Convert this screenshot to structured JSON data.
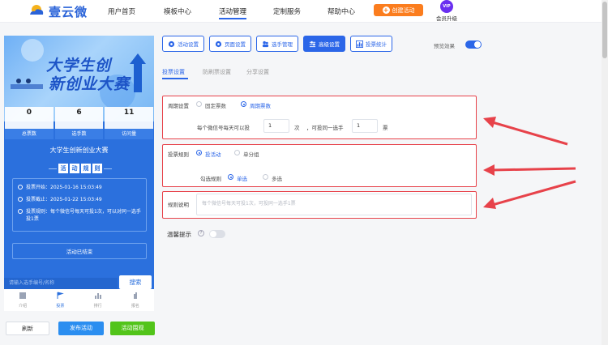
{
  "header": {
    "brand": "壹云微",
    "nav": [
      "用户首页",
      "模板中心",
      "活动管理",
      "定制服务",
      "帮助中心"
    ],
    "active_nav": "活动管理",
    "create_label": "创建活动",
    "vip_badge": "VIP",
    "vip_label": "会员升级"
  },
  "preview": {
    "banner_line1": "大学生创",
    "banner_line2": "新创业大赛",
    "stats": [
      {
        "value": "0",
        "label": "总票数"
      },
      {
        "value": "6",
        "label": "选手数"
      },
      {
        "value": "11",
        "label": "访问量"
      }
    ],
    "title": "大学生创新创业大赛",
    "rule_chars": [
      "活",
      "动",
      "规",
      "则"
    ],
    "rules": [
      "投票开始：2025-01-16 15:03:49",
      "投票截止：2025-01-22 15:03:49",
      "投票规则：每个微信号每天可投1次，可以对同一选手投1票"
    ],
    "end_label": "活动已结束",
    "search_placeholder": "请输入选手编号/名称",
    "search_label": "搜索",
    "tabs": [
      "介绍",
      "投票",
      "排行",
      "报名"
    ],
    "active_tab": "投票"
  },
  "bottom_buttons": {
    "refresh": "刷新",
    "publish": "发布活动",
    "watch": "活动围观"
  },
  "toolbar": {
    "buttons": [
      "活动设置",
      "页面设置",
      "选手管理",
      "高级设置",
      "投票统计"
    ],
    "active": "高级设置",
    "preview_label": "预览效果",
    "preview_on": true
  },
  "subtabs": {
    "items": [
      "投票设置",
      "防刷票设置",
      "分享设置"
    ],
    "active": "投票设置"
  },
  "cycle": {
    "label": "周期设置",
    "options": [
      "固定票数",
      "周期票数"
    ],
    "selected": "周期票数",
    "per_day_label": "每个微信号每天可以投",
    "per_day_value": "1",
    "unit_times": "次",
    "per_player_label": "，可投同一选手",
    "per_player_value": "1",
    "unit_votes": "票"
  },
  "vote_rule": {
    "label": "投票规则",
    "options": [
      "投活动",
      "单分组"
    ],
    "selected": "投活动",
    "check_label": "勾选规则",
    "check_options": [
      "单选",
      "多选"
    ],
    "check_selected": "单选"
  },
  "rule_desc": {
    "label": "规则说明",
    "placeholder": "每个微信号每天可投1次，可投同一选手1票"
  },
  "tip": {
    "label": "温馨提示",
    "help": "?",
    "enabled": false
  },
  "colors": {
    "primary": "#2b66e8",
    "orange": "#fb7d1e",
    "green": "#52c41a",
    "annotation_red": "#e7424a"
  }
}
